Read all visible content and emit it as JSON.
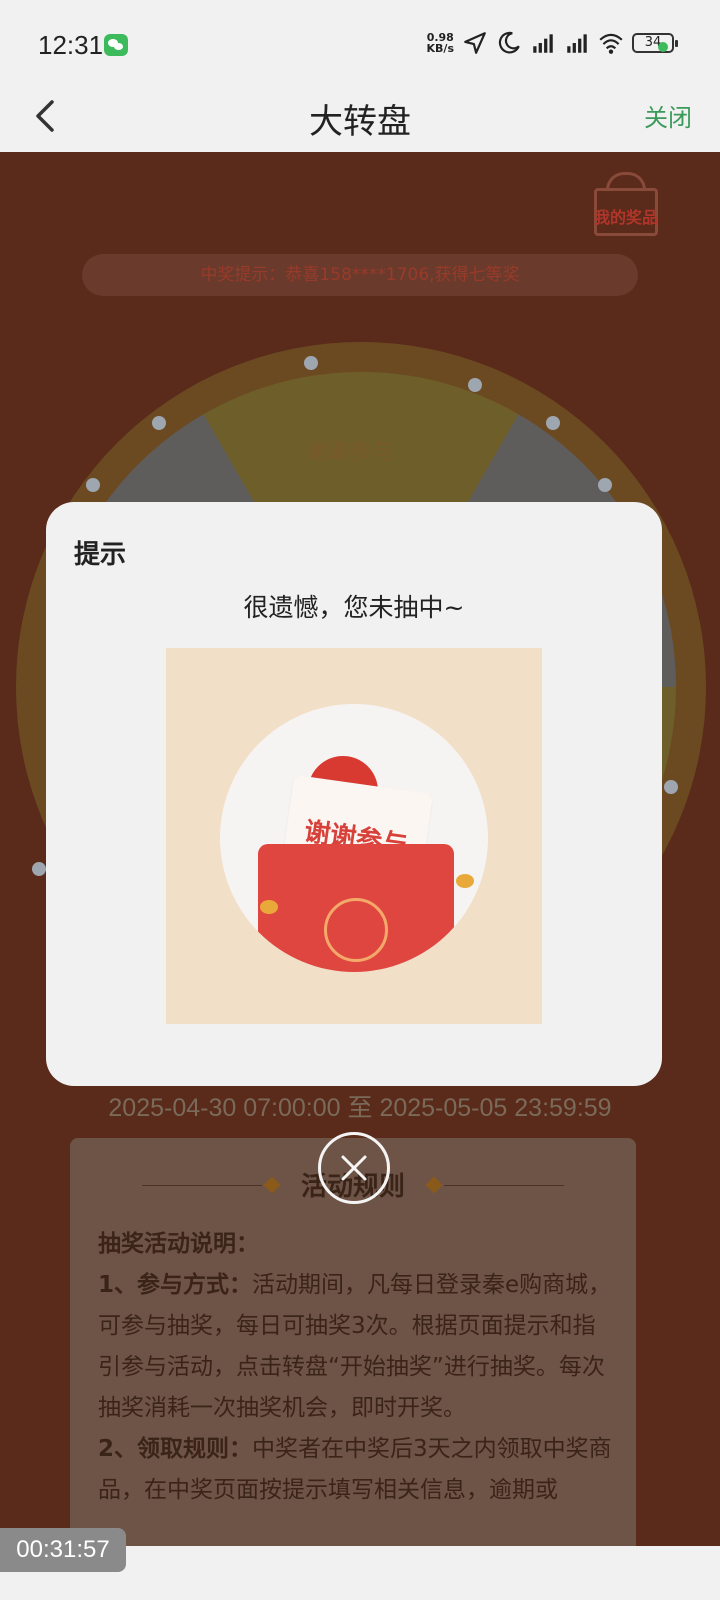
{
  "status_bar": {
    "time": "12:31",
    "net_speed_value": "0.98",
    "net_speed_unit": "KB/s",
    "battery": "34"
  },
  "nav": {
    "title": "大转盘",
    "close_label": "关闭"
  },
  "page": {
    "my_prizes_label": "我的奖品",
    "winner_notice": "中奖提示：恭喜158****1706,获得七等奖",
    "wheel_segment_label": "谢谢参与",
    "date_range": "2025-04-30 07:00:00 至 2025-05-05 23:59:59",
    "rules": {
      "title": "活动规则",
      "heading": "抽奖活动说明：",
      "item1_label": "1、参与方式：",
      "item1_text": "活动期间，凡每日登录秦e购商城，可参与抽奖，每日可抽奖3次。根据页面提示和指引参与活动，点击转盘“开始抽奖”进行抽奖。每次抽奖消耗一次抽奖机会，即时开奖。",
      "item2_label": "2、领取规则：",
      "item2_text": "中奖者在中奖后3天之内领取中奖商品，在中奖页面按提示填写相关信息，逾期或"
    }
  },
  "dialog": {
    "title": "提示",
    "message": "很遗憾，您未抽中~",
    "card_text": "谢谢参与"
  },
  "timer": "00:31:57",
  "colors": {
    "accent_green": "#3a9a5a",
    "dim_background": "#5a2a1a",
    "envelope_red": "#e04640"
  }
}
